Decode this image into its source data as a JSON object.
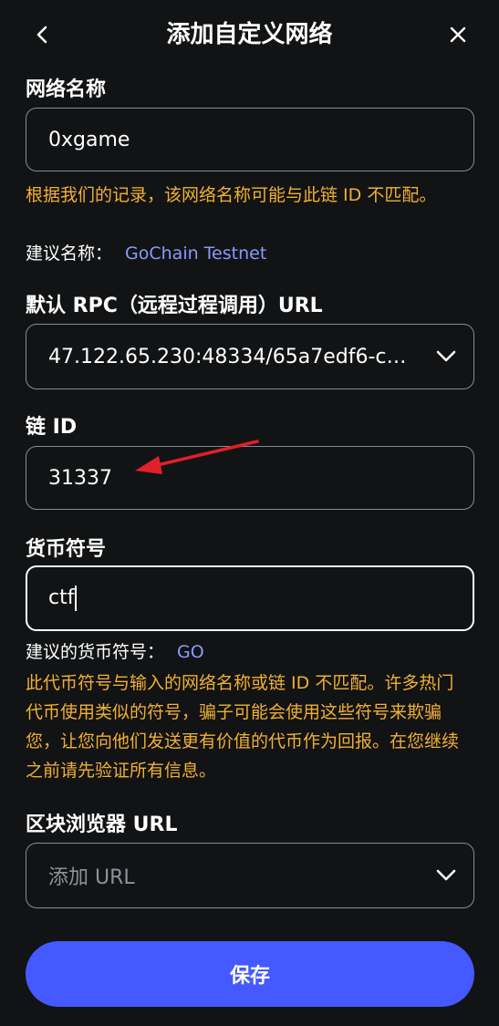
{
  "header": {
    "title": "添加自定义网络"
  },
  "network_name": {
    "label": "网络名称",
    "value": "0xgame",
    "warning": "根据我们的记录，该网络名称可能与此链 ID 不匹配。",
    "suggest_label": "建议名称：",
    "suggest_value": "GoChain Testnet"
  },
  "rpc": {
    "label": "默认 RPC（远程过程调用）URL",
    "value": "47.122.65.230:48334/65a7edf6-c41..."
  },
  "chain_id": {
    "label": "链 ID",
    "value": "31337"
  },
  "currency": {
    "label": "货币符号",
    "value": "ctf",
    "suggest_label": "建议的货币符号：",
    "suggest_value": "GO",
    "warning": "此代币符号与输入的网络名称或链 ID 不匹配。许多热门代币使用类似的符号，骗子可能会使用这些符号来欺骗您，让您向他们发送更有价值的代币作为回报。在您继续之前请先验证所有信息。"
  },
  "explorer": {
    "label": "区块浏览器 URL",
    "placeholder": "添加 URL"
  },
  "footer": {
    "save_label": "保存"
  },
  "colors": {
    "background": "#121314",
    "warning": "#f0b034",
    "link": "#8b99ff",
    "primary_button": "#4459ff",
    "annotation_arrow": "#e0202a"
  },
  "icons": {
    "back": "chevron-left-icon",
    "close": "close-icon",
    "dropdown": "chevron-down-icon"
  }
}
